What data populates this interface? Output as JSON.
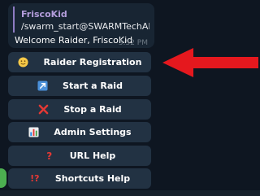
{
  "message": {
    "reply_sender": "FriscoKid",
    "reply_text": "/swarm_start@SWARMTechAI_...",
    "text": "Welcome Raider, FriscoKid",
    "time": "3:52 PM"
  },
  "keyboard": {
    "buttons": [
      {
        "label": "Raider Registration",
        "icon": "smiley-face-icon"
      },
      {
        "label": "Start a Raid",
        "icon": "arrow-up-right-icon"
      },
      {
        "label": "Stop a Raid",
        "icon": "red-cross-icon"
      },
      {
        "label": "Admin Settings",
        "icon": "bar-chart-icon"
      },
      {
        "label": "URL Help",
        "icon": "question-mark-icon"
      },
      {
        "label": "Shortcuts Help",
        "icon": "double-exclamation-question-icon"
      }
    ]
  },
  "colors": {
    "background": "#0e1621",
    "bubble": "#182533",
    "button": "#223243",
    "reply_accent": "#b39ddb",
    "annotation_arrow": "#e5181e"
  }
}
